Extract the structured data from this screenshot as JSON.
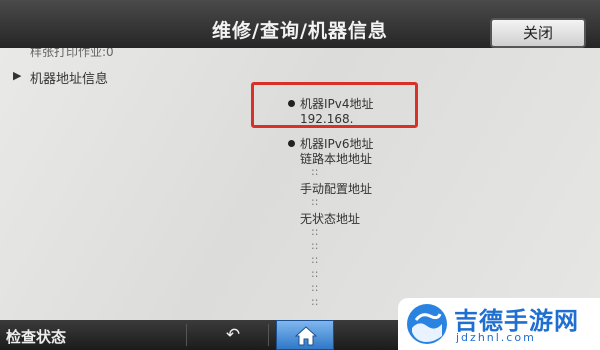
{
  "header": {
    "title": "维修/查询/机器信息",
    "close_label": "关闭"
  },
  "content": {
    "previous_line": "样张打印作业:0",
    "section_label": "机器地址信息",
    "ipv4_label": "机器IPv4地址",
    "ipv4_value": "192.168.",
    "ipv6_label": "机器IPv6地址",
    "link_local_label": "链路本地地址",
    "link_local_value": "::",
    "manual_label": "手动配置地址",
    "manual_value": "::",
    "stateless_label": "无状态地址",
    "stateless_values": [
      "::",
      "::",
      "::",
      "::",
      "::",
      "::"
    ]
  },
  "bottombar": {
    "status_label": "检查状态",
    "back_icon": "back-arrow-icon",
    "home_icon": "home-icon"
  },
  "watermark": {
    "brand_name": "吉德手游网",
    "domain": "jdzhnl.com"
  },
  "colors": {
    "highlight": "#d6322a",
    "home_button": "#3d86d6",
    "brand": "#1f6fd1"
  }
}
